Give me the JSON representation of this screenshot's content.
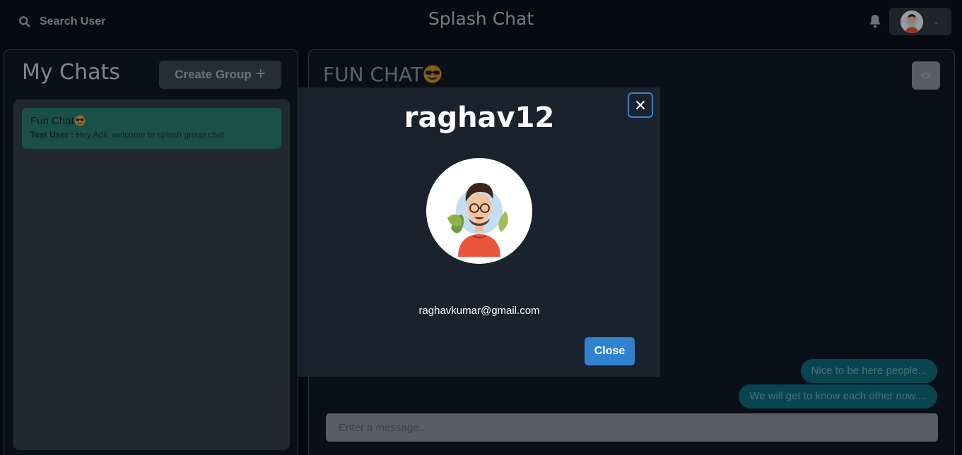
{
  "header": {
    "search_label": "Search User",
    "app_title": "Splash Chat",
    "bell_icon": "bell-icon",
    "profile_chevron_icon": "chevron-down-icon"
  },
  "sidebar": {
    "title": "My Chats",
    "create_group_label": "Create Group",
    "create_group_icon": "plus-icon",
    "chats": [
      {
        "name": "Fun Chat",
        "emoji": "sunglasses-emoji",
        "latest_sender": "Test User :",
        "latest_message": "Hey Adii, welcome to splash group chat."
      }
    ]
  },
  "chat": {
    "title": "FUN CHAT",
    "title_emoji": "sunglasses-emoji",
    "view_icon": "eye-icon",
    "messages": [
      "Nice to be here people...",
      "We will get to know each other now...."
    ],
    "input_placeholder": "Enter a message..."
  },
  "modal": {
    "name": "raghav12",
    "email": "raghavkumar@gmail.com",
    "close_label": "Close",
    "close_icon": "close-icon"
  },
  "colors": {
    "accent": "#3182ce",
    "chat_selected": "#2a7c70",
    "message_bubble": "#0f6b7c",
    "background": "#0a0f17"
  }
}
